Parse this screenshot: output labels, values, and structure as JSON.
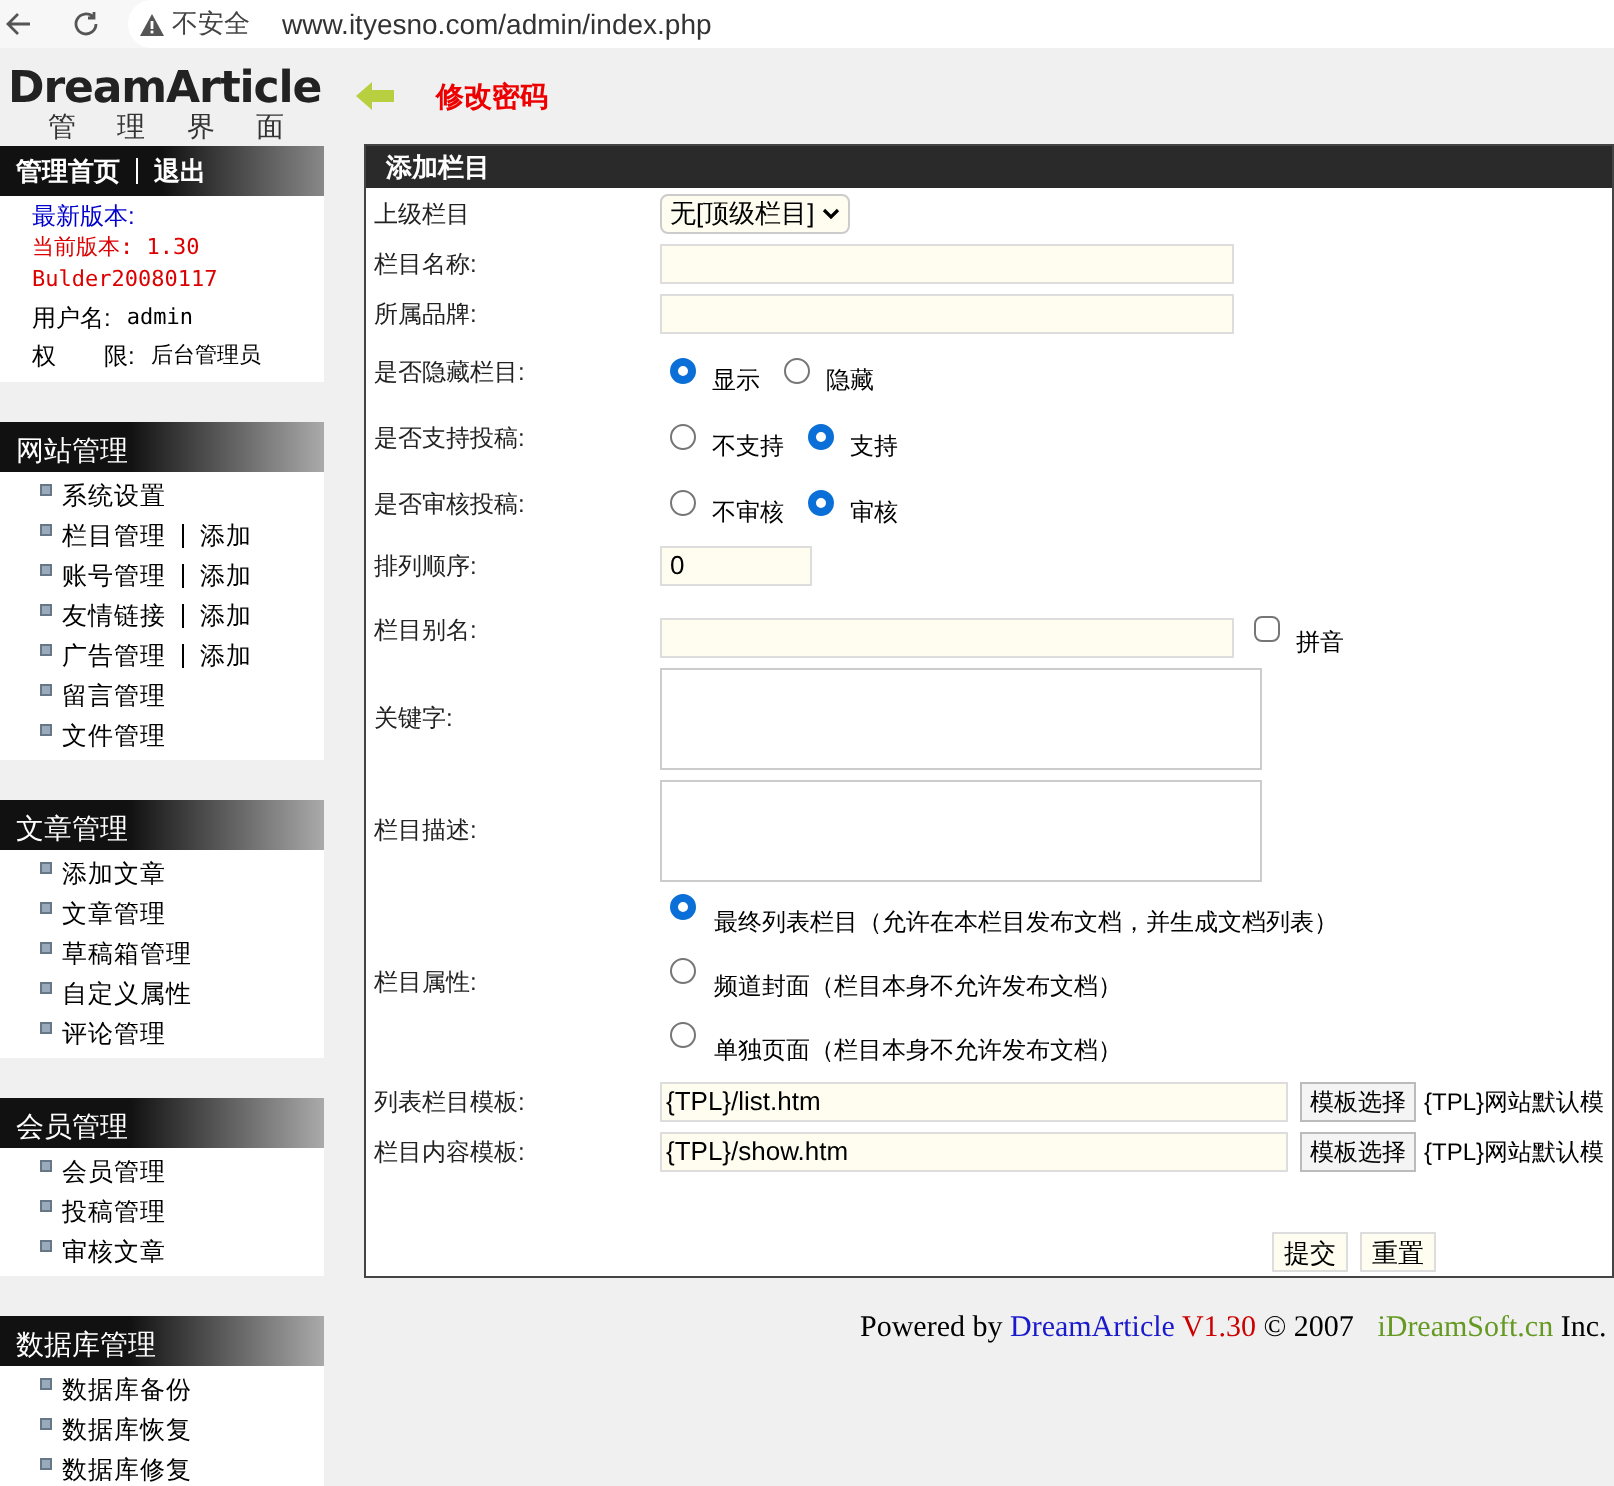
{
  "browser": {
    "security": "不安全",
    "url": "www.ityesno.com/admin/index.php"
  },
  "header": {
    "logo": "DreamArticle",
    "subtitle": [
      "管",
      "理",
      "界",
      "面"
    ],
    "change_password": "修改密码"
  },
  "sidebar": {
    "top_links": [
      "管理首页",
      "退出"
    ],
    "info": [
      {
        "kind": "latest",
        "text": "最新版本:"
      },
      {
        "kind": "version",
        "text": "当前版本: 1.30"
      },
      {
        "kind": "version",
        "text": "Bulder20080117"
      },
      {
        "kind": "user",
        "label": "用户名:",
        "value": "admin"
      },
      {
        "kind": "user",
        "label": "权　　限:",
        "value": "后台管理员"
      }
    ],
    "sections": [
      {
        "title": "网站管理",
        "items": [
          {
            "label": "系统设置"
          },
          {
            "label": "栏目管理",
            "add": "添加"
          },
          {
            "label": "账号管理",
            "add": "添加"
          },
          {
            "label": "友情链接",
            "add": "添加"
          },
          {
            "label": "广告管理",
            "add": "添加"
          },
          {
            "label": "留言管理"
          },
          {
            "label": "文件管理"
          }
        ]
      },
      {
        "title": "文章管理",
        "items": [
          {
            "label": "添加文章"
          },
          {
            "label": "文章管理"
          },
          {
            "label": "草稿箱管理"
          },
          {
            "label": "自定义属性"
          },
          {
            "label": "评论管理"
          }
        ]
      },
      {
        "title": "会员管理",
        "items": [
          {
            "label": "会员管理"
          },
          {
            "label": "投稿管理"
          },
          {
            "label": "审核文章"
          }
        ]
      },
      {
        "title": "数据库管理",
        "items": [
          {
            "label": "数据库备份"
          },
          {
            "label": "数据库恢复"
          },
          {
            "label": "数据库修复"
          }
        ]
      }
    ]
  },
  "form": {
    "title": "添加栏目",
    "rows": [
      {
        "kind": "select",
        "label": "上级栏目",
        "value": "无[顶级栏目]"
      },
      {
        "kind": "text",
        "label": "栏目名称:"
      },
      {
        "kind": "text",
        "label": "所属品牌:"
      },
      {
        "kind": "radio",
        "label": "是否隐藏栏目:",
        "options": [
          {
            "label": "显示",
            "selected": true
          },
          {
            "label": "隐藏",
            "selected": false
          }
        ]
      },
      {
        "kind": "radio",
        "label": "是否支持投稿:",
        "options": [
          {
            "label": "不支持",
            "selected": false
          },
          {
            "label": "支持",
            "selected": true
          }
        ]
      },
      {
        "kind": "radio",
        "label": "是否审核投稿:",
        "options": [
          {
            "label": "不审核",
            "selected": false
          },
          {
            "label": "审核",
            "selected": true
          }
        ]
      },
      {
        "kind": "short",
        "label": "排列顺序:",
        "value": "0"
      },
      {
        "kind": "checktext",
        "label": "栏目别名:",
        "check_label": "拼音",
        "checked": false
      },
      {
        "kind": "textarea",
        "label": "关键字:"
      },
      {
        "kind": "textarea",
        "label": "栏目描述:"
      },
      {
        "kind": "stack",
        "label": "栏目属性:",
        "options": [
          {
            "label": "最终列表栏目（允许在本栏目发布文档，并生成文档列表）",
            "selected": true
          },
          {
            "label": "频道封面（栏目本身不允许发布文档）",
            "selected": false
          },
          {
            "label": "单独页面（栏目本身不允许发布文档）",
            "selected": false
          }
        ]
      },
      {
        "kind": "template",
        "label": "列表栏目模板:",
        "value": "{TPL}/list.htm",
        "button": "模板选择",
        "note": "{TPL}网站默认模"
      },
      {
        "kind": "template",
        "label": "栏目内容模板:",
        "value": "{TPL}/show.htm",
        "button": "模板选择",
        "note": "{TPL}网站默认模"
      }
    ],
    "buttons": [
      "提交",
      "重置"
    ]
  },
  "footer": [
    {
      "kind": "plain",
      "text": "Powered by"
    },
    {
      "kind": "brand",
      "text": "DreamArticle"
    },
    {
      "kind": "version",
      "text": "V1.30"
    },
    {
      "kind": "plain",
      "text": "© 2007"
    },
    {
      "kind": "company",
      "text": "iDreamSoft.cn"
    },
    {
      "kind": "plain",
      "text": "Inc."
    }
  ]
}
